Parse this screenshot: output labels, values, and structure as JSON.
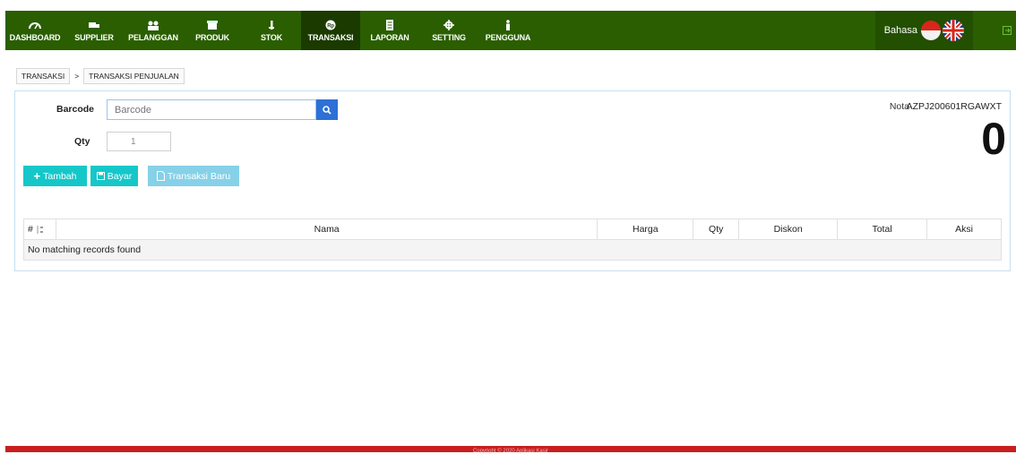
{
  "nav": {
    "items": [
      {
        "label": "DASHBOARD",
        "icon": "dashboard-icon",
        "active": false
      },
      {
        "label": "SUPPLIER",
        "icon": "truck-icon",
        "active": false
      },
      {
        "label": "PELANGGAN",
        "icon": "users-icon",
        "active": false
      },
      {
        "label": "PRODUK",
        "icon": "box-icon",
        "active": false
      },
      {
        "label": "STOK",
        "icon": "stock-icon",
        "active": false
      },
      {
        "label": "TRANSAKSI",
        "icon": "rupiah-icon",
        "active": true
      },
      {
        "label": "LAPORAN",
        "icon": "report-icon",
        "active": false
      },
      {
        "label": "SETTING",
        "icon": "gear-icon",
        "active": false
      },
      {
        "label": "PENGGUNA",
        "icon": "user-icon",
        "active": false
      }
    ],
    "language_label": "Bahasa",
    "colors": {
      "bar": "#2a5e00",
      "active": "#1a3a00"
    }
  },
  "breadcrumb": {
    "items": [
      "TRANSAKSI",
      "TRANSAKSI PENJUALAN"
    ],
    "separator": ">"
  },
  "form": {
    "barcode_label": "Barcode",
    "barcode_placeholder": "Barcode",
    "qty_label": "Qty",
    "qty_value": "1",
    "nota_label": "Nota",
    "nota_value": "AZPJ200601RGAWXT",
    "total_value": "0"
  },
  "buttons": {
    "tambah": "Tambah",
    "bayar": "Bayar",
    "transaksi_baru": "Transaksi Baru"
  },
  "table": {
    "columns": [
      "#",
      "Nama",
      "Harga",
      "Qty",
      "Diskon",
      "Total",
      "Aksi"
    ],
    "empty_message": "No matching records found"
  },
  "footer": {
    "text": "Copyright © 2020 Aplikasi Kasir"
  }
}
